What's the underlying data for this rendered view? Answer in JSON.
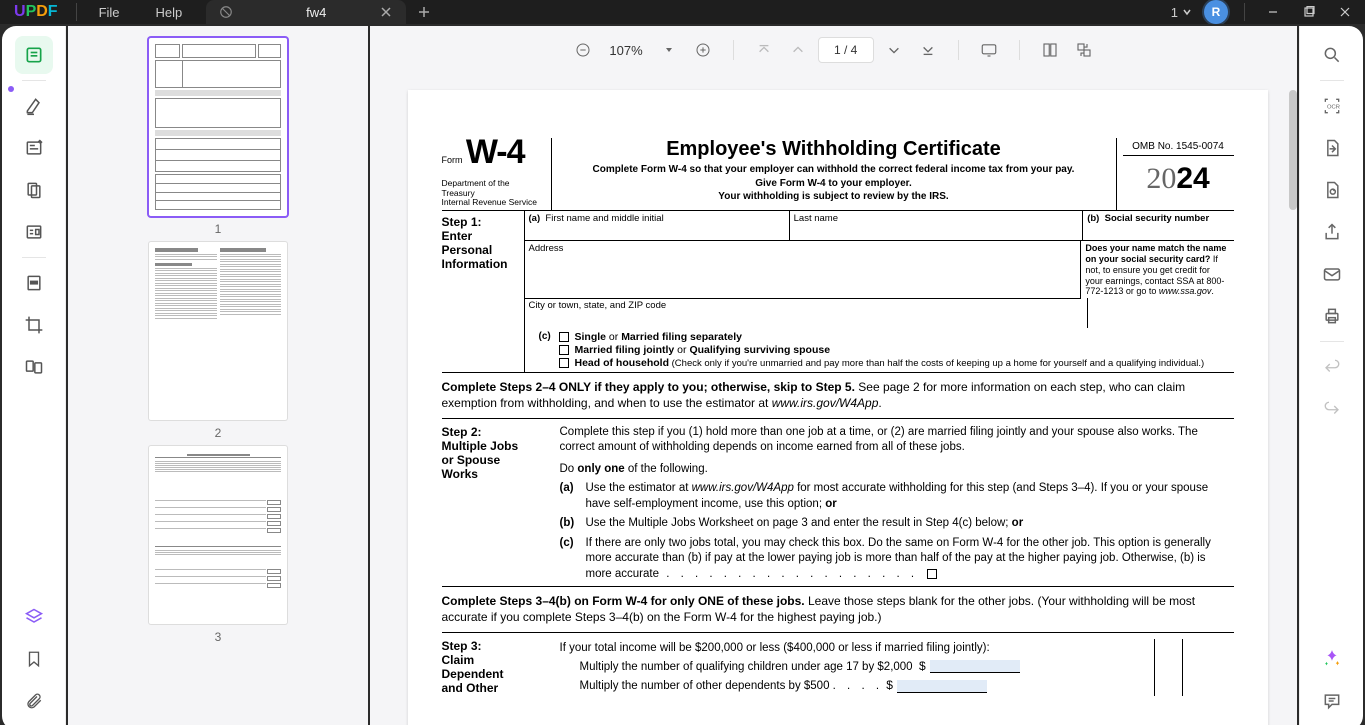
{
  "menu": {
    "file": "File",
    "help": "Help"
  },
  "tab": {
    "title": "fw4"
  },
  "titlebar": {
    "count": "1",
    "avatar": "R"
  },
  "toolbar": {
    "zoom": "107%",
    "page": "1 / 4"
  },
  "thumbs": {
    "p1": "1",
    "p2": "2",
    "p3": "3"
  },
  "doc": {
    "form_label": "Form",
    "form_code": "W-4",
    "dept1": "Department of the Treasury",
    "dept2": "Internal Revenue Service",
    "title": "Employee's Withholding Certificate",
    "sub1": "Complete Form W-4 so that your employer can withhold the correct federal income tax from your pay.",
    "sub2": "Give Form W-4 to your employer.",
    "sub3": "Your withholding is subject to review by the IRS.",
    "omb": "OMB No. 1545-0074",
    "year_cc": "20",
    "year_yy": "24",
    "step1": {
      "h": "Step 1:",
      "t1": "Enter",
      "t2": "Personal",
      "t3": "Information",
      "a": "(a)",
      "first": "First name and middle initial",
      "last": "Last name",
      "b": "(b)",
      "ssn": "Social security number",
      "addr": "Address",
      "city": "City or town, state, and ZIP code",
      "match": "Does your name match the name on your social security card?",
      "match2": " If not, to ensure you get credit for your earnings, contact SSA at 800-772-1213 or go to ",
      "match3": "www.ssa.gov",
      "c": "(c)",
      "f1a": "Single",
      "f1b": " or ",
      "f1c": "Married filing separately",
      "f2a": "Married filing jointly",
      "f2b": " or ",
      "f2c": "Qualifying surviving spouse",
      "f3a": "Head of household",
      "f3b": " (Check only if you're unmarried and pay more than half the costs of keeping up a home for yourself and a qualifying individual.)"
    },
    "instr1a": "Complete Steps 2–4 ONLY if they apply to you; otherwise, skip to Step 5.",
    "instr1b": " See page 2 for more information on each step, who can claim exemption from withholding, and when to use the estimator at ",
    "instr1c": "www.irs.gov/W4App",
    "step2": {
      "h": "Step 2:",
      "t1": "Multiple Jobs",
      "t2": "or Spouse",
      "t3": "Works",
      "p1": "Complete this step if you (1) hold more than one job at a time, or (2) are married filing jointly and your spouse also works. The correct amount of withholding depends on income earned from all of these jobs.",
      "do1": "Do ",
      "do2": "only one",
      "do3": " of the following.",
      "a": "(a)",
      "at": "Use the estimator at ",
      "ai": "www.irs.gov/W4App",
      "at2": " for most accurate withholding for this step (and Steps 3–4). If you or your spouse have self-employment income, use this option; ",
      "aor": "or",
      "b": "(b)",
      "bt": "Use the Multiple Jobs Worksheet on page 3 and enter the result in Step 4(c) below; ",
      "bor": "or",
      "c": "(c)",
      "ct": "If there are only two jobs total, you may check this box. Do the same on Form W-4 for the other job. This option is generally more accurate than (b) if pay at the lower paying job is more than half of the pay at the higher paying job. Otherwise, (b) is more accurate",
      "dots": "  .    .    .    .    .    .    .    .    .    .    .    .    .    .    .    .    .    ."
    },
    "instr2a": "Complete Steps 3–4(b) on Form W-4 for only ONE of these jobs.",
    "instr2b": " Leave those steps blank for the other jobs. (Your withholding will be most accurate if you complete Steps 3–4(b) on the Form W-4 for the highest paying job.)",
    "step3": {
      "h": "Step 3:",
      "t1": "Claim",
      "t2": "Dependent",
      "t3": "and Other",
      "p1": "If your total income will be $200,000 or less ($400,000 or less if married filing jointly):",
      "l1": "Multiply the number of qualifying children under age 17 by $2,000",
      "l2": "Multiply the number of other dependents by $500",
      "dots": ".   .   .   .",
      "d": "$"
    }
  }
}
